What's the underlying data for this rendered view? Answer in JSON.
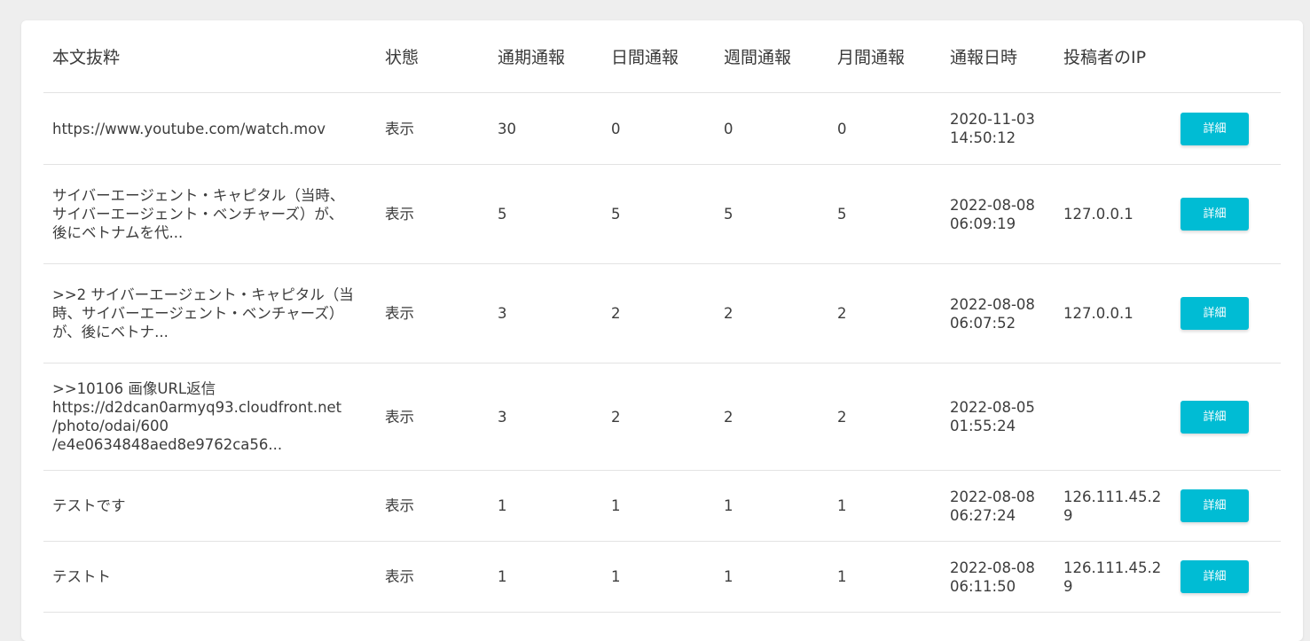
{
  "table": {
    "headers": [
      "本文抜粋",
      "状態",
      "通期通報",
      "日間通報",
      "週間通報",
      "月間通報",
      "通報日時",
      "投稿者のIP",
      ""
    ],
    "detail_label": "詳細",
    "rows": [
      {
        "excerpt": [
          "https://www.youtube.com/watch.mov"
        ],
        "status": "表示",
        "total": "30",
        "daily": "0",
        "weekly": "0",
        "monthly": "0",
        "datetime": [
          "2020-11-03",
          "14:50:12"
        ],
        "ip": ""
      },
      {
        "excerpt": [
          "サイバーエージェント・キャピタル（当時、",
          "サイバーエージェント・ベンチャーズ）が、",
          "後にベトナムを代..."
        ],
        "status": "表示",
        "total": "5",
        "daily": "5",
        "weekly": "5",
        "monthly": "5",
        "datetime": [
          "2022-08-08",
          "06:09:19"
        ],
        "ip": "127.0.0.1"
      },
      {
        "excerpt": [
          ">>2 サイバーエージェント・キャピタル（当",
          "時、サイバーエージェント・ベンチャーズ）",
          "が、後にベトナ..."
        ],
        "status": "表示",
        "total": "3",
        "daily": "2",
        "weekly": "2",
        "monthly": "2",
        "datetime": [
          "2022-08-08",
          "06:07:52"
        ],
        "ip": "127.0.0.1"
      },
      {
        "excerpt": [
          ">>10106 画像URL返信",
          "https://d2dcan0armyq93.cloudfront.net",
          "/photo/odai/600",
          "/e4e0634848aed8e9762ca56..."
        ],
        "status": "表示",
        "total": "3",
        "daily": "2",
        "weekly": "2",
        "monthly": "2",
        "datetime": [
          "2022-08-05",
          "01:55:24"
        ],
        "ip": ""
      },
      {
        "excerpt": [
          "テストです"
        ],
        "status": "表示",
        "total": "1",
        "daily": "1",
        "weekly": "1",
        "monthly": "1",
        "datetime": [
          "2022-08-08",
          "06:27:24"
        ],
        "ip": "126.111.45.29"
      },
      {
        "excerpt": [
          "テストト"
        ],
        "status": "表示",
        "total": "1",
        "daily": "1",
        "weekly": "1",
        "monthly": "1",
        "datetime": [
          "2022-08-08",
          "06:11:50"
        ],
        "ip": "126.111.45.29"
      }
    ]
  },
  "colors": {
    "button": "#00bcd4",
    "background": "#eeeeee",
    "card": "#ffffff",
    "divider": "#e3e3e3"
  }
}
